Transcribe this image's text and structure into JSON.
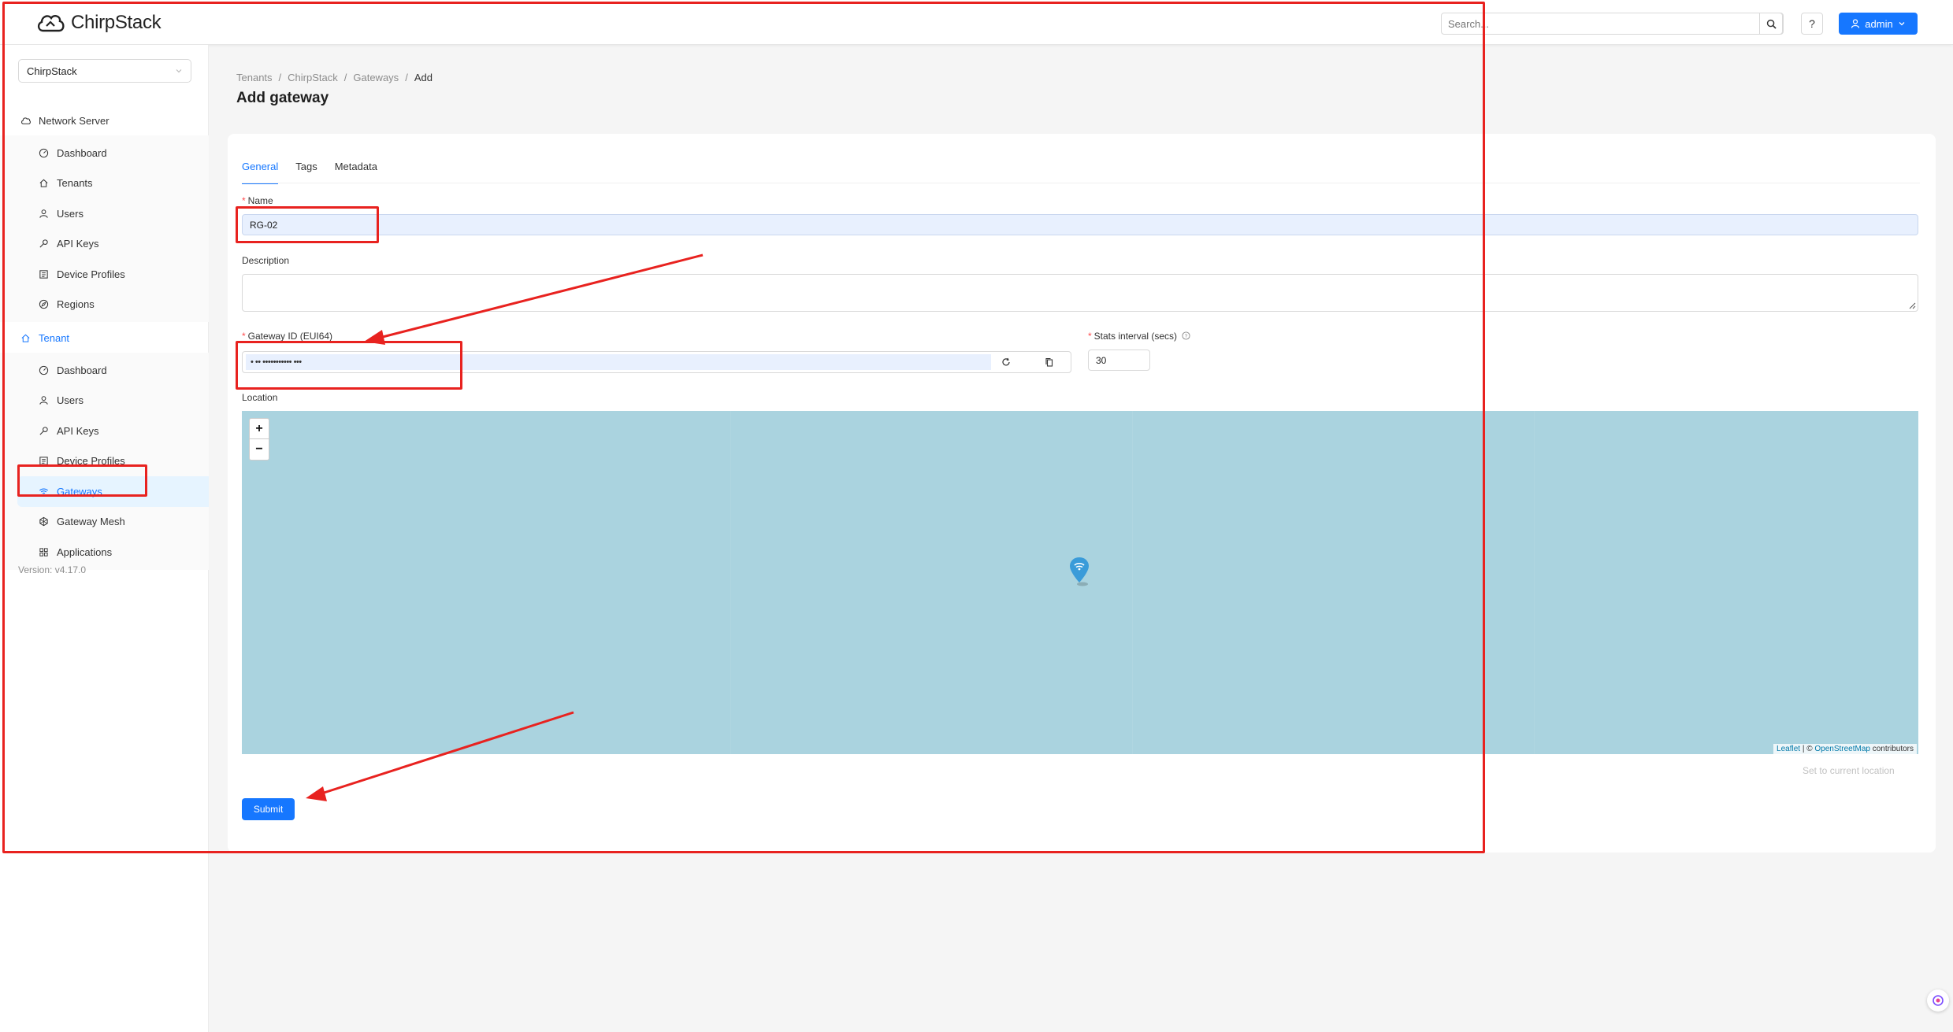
{
  "header": {
    "logo_text": "ChirpStack",
    "search_placeholder": "Search...",
    "help_label": "?",
    "user_label": "admin"
  },
  "sidebar": {
    "tenant_select": "ChirpStack",
    "network_server": {
      "title": "Network Server",
      "items": [
        "Dashboard",
        "Tenants",
        "Users",
        "API Keys",
        "Device Profiles",
        "Regions"
      ]
    },
    "tenant": {
      "title": "Tenant",
      "items": [
        "Dashboard",
        "Users",
        "API Keys",
        "Device Profiles",
        "Gateways",
        "Gateway Mesh",
        "Applications"
      ],
      "selected": "Gateways"
    },
    "version": "Version: v4.17.0"
  },
  "breadcrumb": [
    "Tenants",
    "ChirpStack",
    "Gateways",
    "Add"
  ],
  "page_title": "Add gateway",
  "tabs": [
    "General",
    "Tags",
    "Metadata"
  ],
  "form": {
    "name_label": "Name",
    "name_value": "RG-02",
    "description_label": "Description",
    "description_value": "",
    "gateway_id_label": "Gateway ID (EUI64)",
    "gateway_id_value": "• •• ••••••••••• •••",
    "stats_interval_label": "Stats interval (secs)",
    "stats_interval_value": "30",
    "location_label": "Location",
    "set_location_label": "Set to current location",
    "submit_label": "Submit"
  },
  "map": {
    "zoom_in": "+",
    "zoom_out": "−",
    "attribution_leaflet": "Leaflet",
    "attribution_sep": " | © ",
    "attribution_osm": "OpenStreetMap",
    "attribution_tail": " contributors"
  },
  "colors": {
    "primary": "#1677ff",
    "annotation": "#e8221f",
    "map_water": "#aad3df"
  }
}
